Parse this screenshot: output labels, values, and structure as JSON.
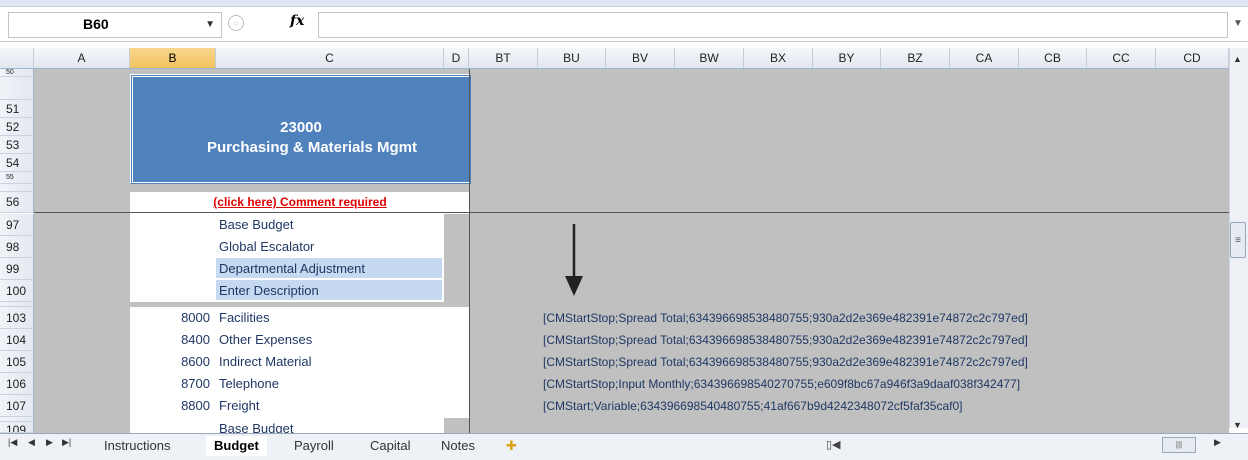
{
  "formula_bar": {
    "name_box": "B60",
    "fx_label": "fx",
    "formula": ""
  },
  "columns": [
    "A",
    "B",
    "C",
    "D",
    "BT",
    "BU",
    "BV",
    "BW",
    "BX",
    "BY",
    "BZ",
    "CA",
    "CB",
    "CC",
    "CD"
  ],
  "selected_column": "B",
  "rows": {
    "r50": "50",
    "r51": "51",
    "r52": "52",
    "r53": "53",
    "r54": "54",
    "r55": "55",
    "r56": "56",
    "r97": "97",
    "r98": "98",
    "r99": "99",
    "r100": "100",
    "r103": "103",
    "r104": "104",
    "r105": "105",
    "r106": "106",
    "r107": "107",
    "r109": "109"
  },
  "header": {
    "code": "23000",
    "name": "Purchasing & Materials Mgmt",
    "comment_link": "(click here) Comment required"
  },
  "budget_lines": {
    "base": "Base Budget",
    "escalator": "Global Escalator",
    "dept_adj": "Departmental Adjustment",
    "enter_desc": "Enter Description",
    "base2": "Base Budget"
  },
  "accounts": [
    {
      "code": "8000",
      "name": "Facilities"
    },
    {
      "code": "8400",
      "name": "Other Expenses"
    },
    {
      "code": "8600",
      "name": "Indirect Material"
    },
    {
      "code": "8700",
      "name": "Telephone"
    },
    {
      "code": "8800",
      "name": "Freight"
    }
  ],
  "cm_tags": [
    "[CMStartStop;Spread Total;634396698538480755;930a2d2e369e482391e74872c2c797ed]",
    "[CMStartStop;Spread Total;634396698538480755;930a2d2e369e482391e74872c2c797ed]",
    "[CMStartStop;Spread Total;634396698538480755;930a2d2e369e482391e74872c2c797ed]",
    "[CMStartStop;Input Monthly;634396698540270755;e609f8bc67a946f3a9daaf038f342477]",
    "[CMStart;Variable;634396698540480755;41af667b9d4242348072cf5faf35caf0]"
  ],
  "tabs": {
    "instructions": "Instructions",
    "budget": "Budget",
    "payroll": "Payroll",
    "capital": "Capital",
    "notes": "Notes"
  },
  "colors": {
    "title_fill": "#4f81bd",
    "grid_grey": "#c0c0c0",
    "adjust_fill": "#c5d9f1",
    "link_red": "#e00000",
    "text_navy": "#1f3864"
  }
}
